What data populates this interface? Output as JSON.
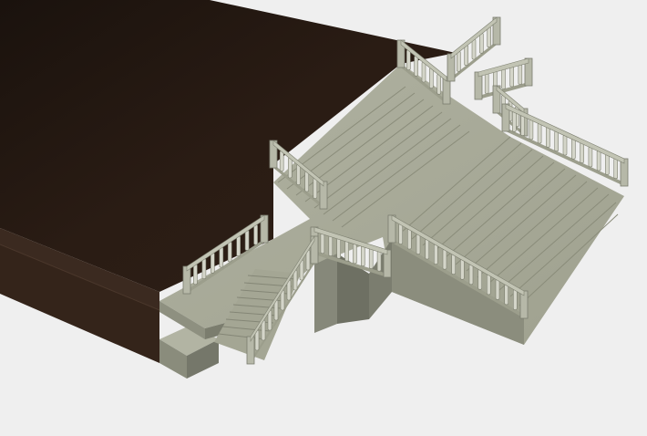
{
  "scene": {
    "subject": "3d-model-grand-staircase-with-balustrades",
    "colors": {
      "background": "#efefef",
      "deck_top": "#2a1c14",
      "deck_side": "#3a271b",
      "stone_top": "#a9ab9a",
      "stone_side": "#7d7f70",
      "stone_dark": "#65675a",
      "baluster": "#d6d7cc",
      "step_line": "#8f917f"
    }
  }
}
